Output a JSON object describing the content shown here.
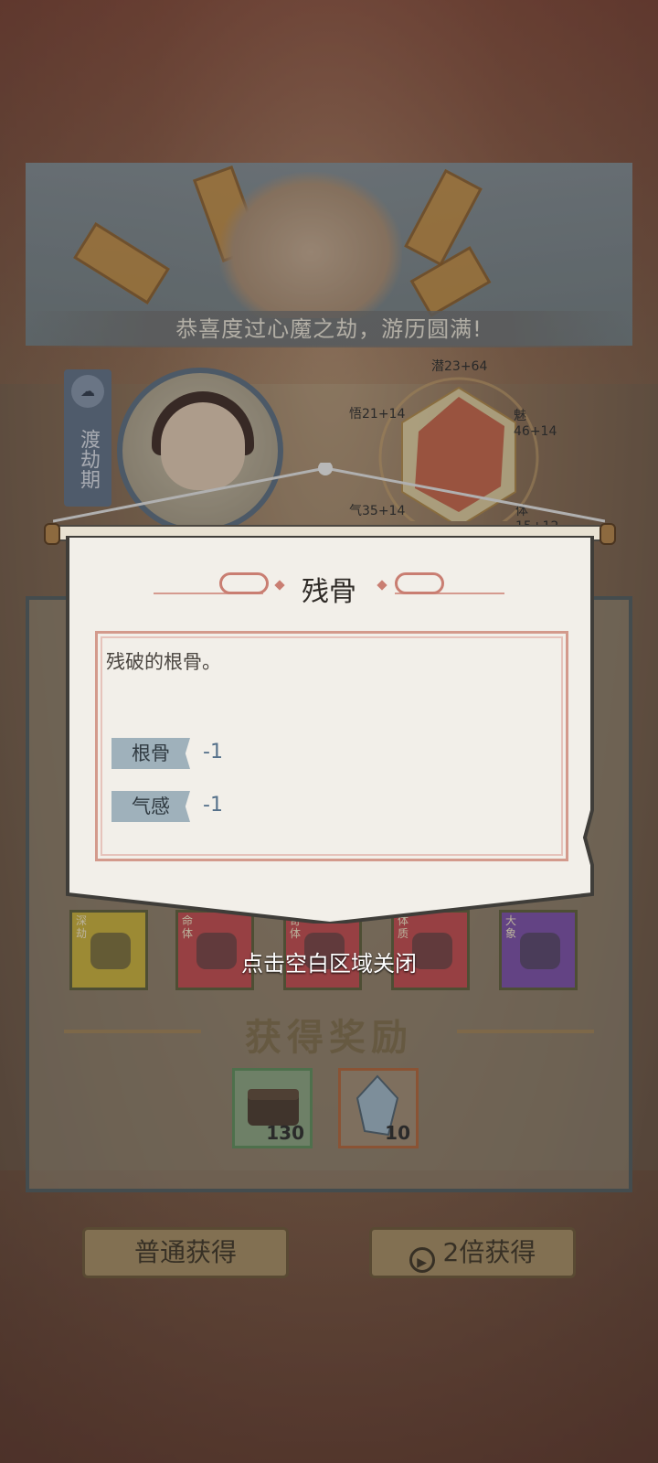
{
  "banner": {
    "message": "恭喜度过心魔之劫，游历圆满!"
  },
  "character": {
    "realm": "渡劫期",
    "realm_icon": "cloud-icon"
  },
  "radar": {
    "labels": [
      {
        "key": "qian",
        "text": "潜23+64"
      },
      {
        "key": "wu",
        "text": "悟21+14"
      },
      {
        "key": "mei",
        "text": "魅46+14"
      },
      {
        "key": "qi",
        "text": "气35+14"
      },
      {
        "key": "ti",
        "text": "体15+12"
      }
    ]
  },
  "popup": {
    "title": "残骨",
    "description": "残破的根骨。",
    "attributes": [
      {
        "name": "根骨",
        "value": "-1"
      },
      {
        "name": "气感",
        "value": "-1"
      }
    ],
    "close_hint": "点击空白区域关闭"
  },
  "cards": [
    {
      "tag": "深劫",
      "color": "#c9b03a"
    },
    {
      "tag": "命体",
      "color": "#c24a4e"
    },
    {
      "tag": "奇体",
      "color": "#c24a4e"
    },
    {
      "tag": "体质",
      "color": "#c24a4e"
    },
    {
      "tag": "大象",
      "color": "#7a4ea8"
    }
  ],
  "rewards": {
    "title": "获得奖励",
    "items": [
      {
        "name": "chest-icon",
        "qty": "130",
        "color": "#5d8c5a"
      },
      {
        "name": "crystal-icon",
        "qty": "10",
        "color": "#b0643a"
      }
    ]
  },
  "buttons": {
    "normal": "普通获得",
    "double": "2倍获得",
    "double_icon": "play-icon"
  }
}
